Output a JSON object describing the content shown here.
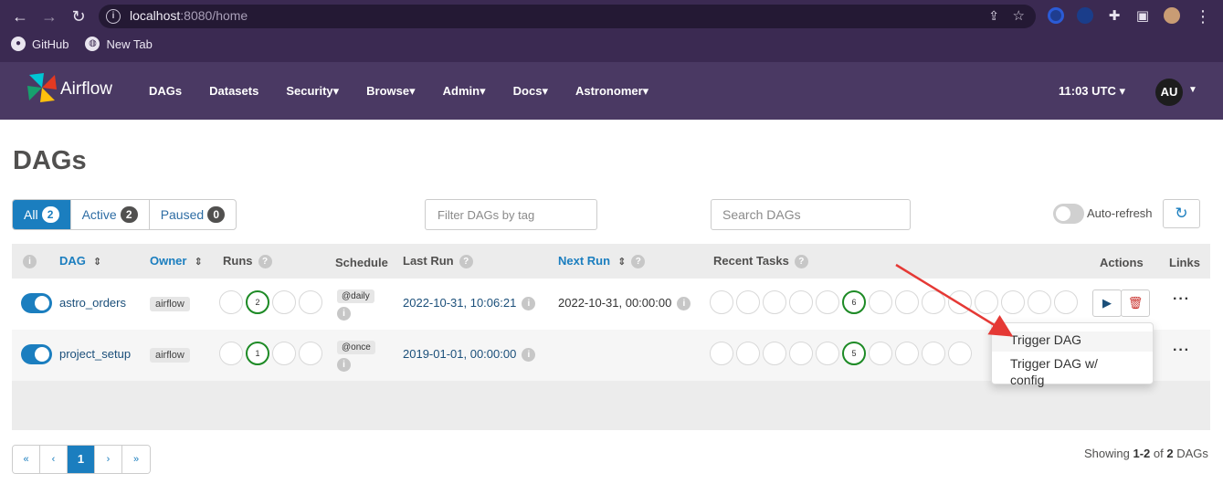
{
  "browser": {
    "url_host": "localhost",
    "url_rest": ":8080/home",
    "bookmarks": [
      "GitHub",
      "New Tab"
    ]
  },
  "navbar": {
    "brand": "Airflow",
    "menu": [
      "DAGs",
      "Datasets",
      "Security",
      "Browse",
      "Admin",
      "Docs",
      "Astronomer"
    ],
    "clock": "11:03 UTC",
    "avatar": "AU"
  },
  "page": {
    "title": "DAGs",
    "filters": {
      "all_label": "All",
      "all_count": "2",
      "active_label": "Active",
      "active_count": "2",
      "paused_label": "Paused",
      "paused_count": "0"
    },
    "tag_placeholder": "Filter DAGs by tag",
    "search_placeholder": "Search DAGs",
    "autorefresh": "Auto-refresh"
  },
  "table": {
    "headers": {
      "dag": "DAG",
      "owner": "Owner",
      "runs": "Runs",
      "schedule": "Schedule",
      "last_run": "Last Run",
      "next_run": "Next Run",
      "recent_tasks": "Recent Tasks",
      "actions": "Actions",
      "links": "Links"
    },
    "rows": [
      {
        "dag_id": "astro_orders",
        "owner": "airflow",
        "runs_count": "2",
        "schedule": "@daily",
        "last_run": "2022-10-31, 10:06:21",
        "next_run": "2022-10-31, 00:00:00",
        "tasks_count": "6"
      },
      {
        "dag_id": "project_setup",
        "owner": "airflow",
        "runs_count": "1",
        "schedule": "@once",
        "last_run": "2019-01-01, 00:00:00",
        "next_run": "",
        "tasks_count": "5"
      }
    ]
  },
  "dropdown": {
    "item1": "Trigger DAG",
    "item2": "Trigger DAG w/ config"
  },
  "pagination": {
    "first": "«",
    "prev": "‹",
    "current": "1",
    "next": "›",
    "last": "»"
  },
  "footer": {
    "showing_prefix": "Showing ",
    "range": "1-2",
    "of": " of ",
    "total": "2",
    "suffix": " DAGs"
  },
  "colors": {
    "navbar": "#4a3963",
    "accent": "#1b7ebf",
    "success": "#1d8a25",
    "annotation": "#e53935"
  }
}
